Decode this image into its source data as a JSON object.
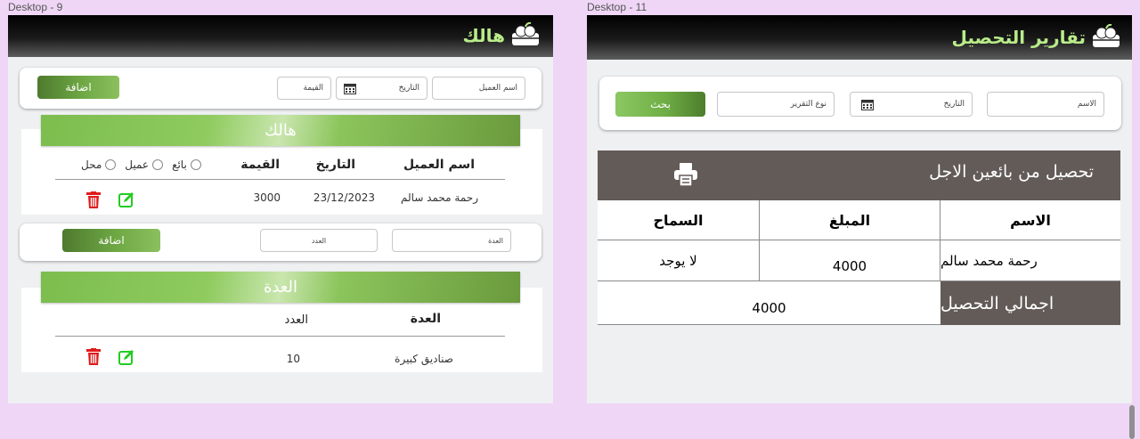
{
  "frames": {
    "left_label": "Desktop - 9",
    "right_label": "Desktop - 11"
  },
  "left": {
    "brand_title": "هالك",
    "form1": {
      "customer_placeholder": "اسم العميل",
      "date_placeholder": "التاريخ",
      "value_placeholder": "القيمة",
      "add_label": "اضافة"
    },
    "section1": {
      "title": "هالك",
      "columns": [
        "اسم العميل",
        "التاريخ",
        "القيمة"
      ],
      "radio_options": [
        "بائع",
        "عميل",
        "محل"
      ],
      "rows": [
        {
          "customer": "رحمة محمد سالم",
          "date": "23/12/2023",
          "value": "3000"
        }
      ]
    },
    "form2": {
      "equipment_placeholder": "العدة",
      "count_placeholder": "العدد",
      "add_label": "اضافة"
    },
    "section2": {
      "title": "العدة",
      "columns": [
        "العدة",
        "العدد"
      ],
      "rows": [
        {
          "equipment": "صناديق كبيرة",
          "count": "10"
        }
      ]
    }
  },
  "right": {
    "brand_title": "تقارير التحصيل",
    "search": {
      "name_placeholder": "الاسم",
      "date_placeholder": "التاريخ",
      "report_type_placeholder": "نوع التقرير",
      "search_label": "بحث"
    },
    "report": {
      "title": "تحصيل من بائعين الاجل",
      "columns": [
        "الاسم",
        "المبلغ",
        "السماح"
      ],
      "rows": [
        {
          "name": "رحمة محمد سالم",
          "amount": "4000",
          "allowance": "لا يوجد"
        }
      ],
      "total_label": "اجمالي التحصيل",
      "total_value": "4000"
    }
  },
  "colors": {
    "accent_green": "#7cbd4e",
    "brand_text": "#b9ec8a",
    "delete_red": "#e01b1b",
    "edit_green": "#22cc22",
    "report_bar": "#625b58"
  },
  "icons": [
    "logo-icon",
    "calendar-icon",
    "delete-icon",
    "edit-icon",
    "printer-icon"
  ]
}
